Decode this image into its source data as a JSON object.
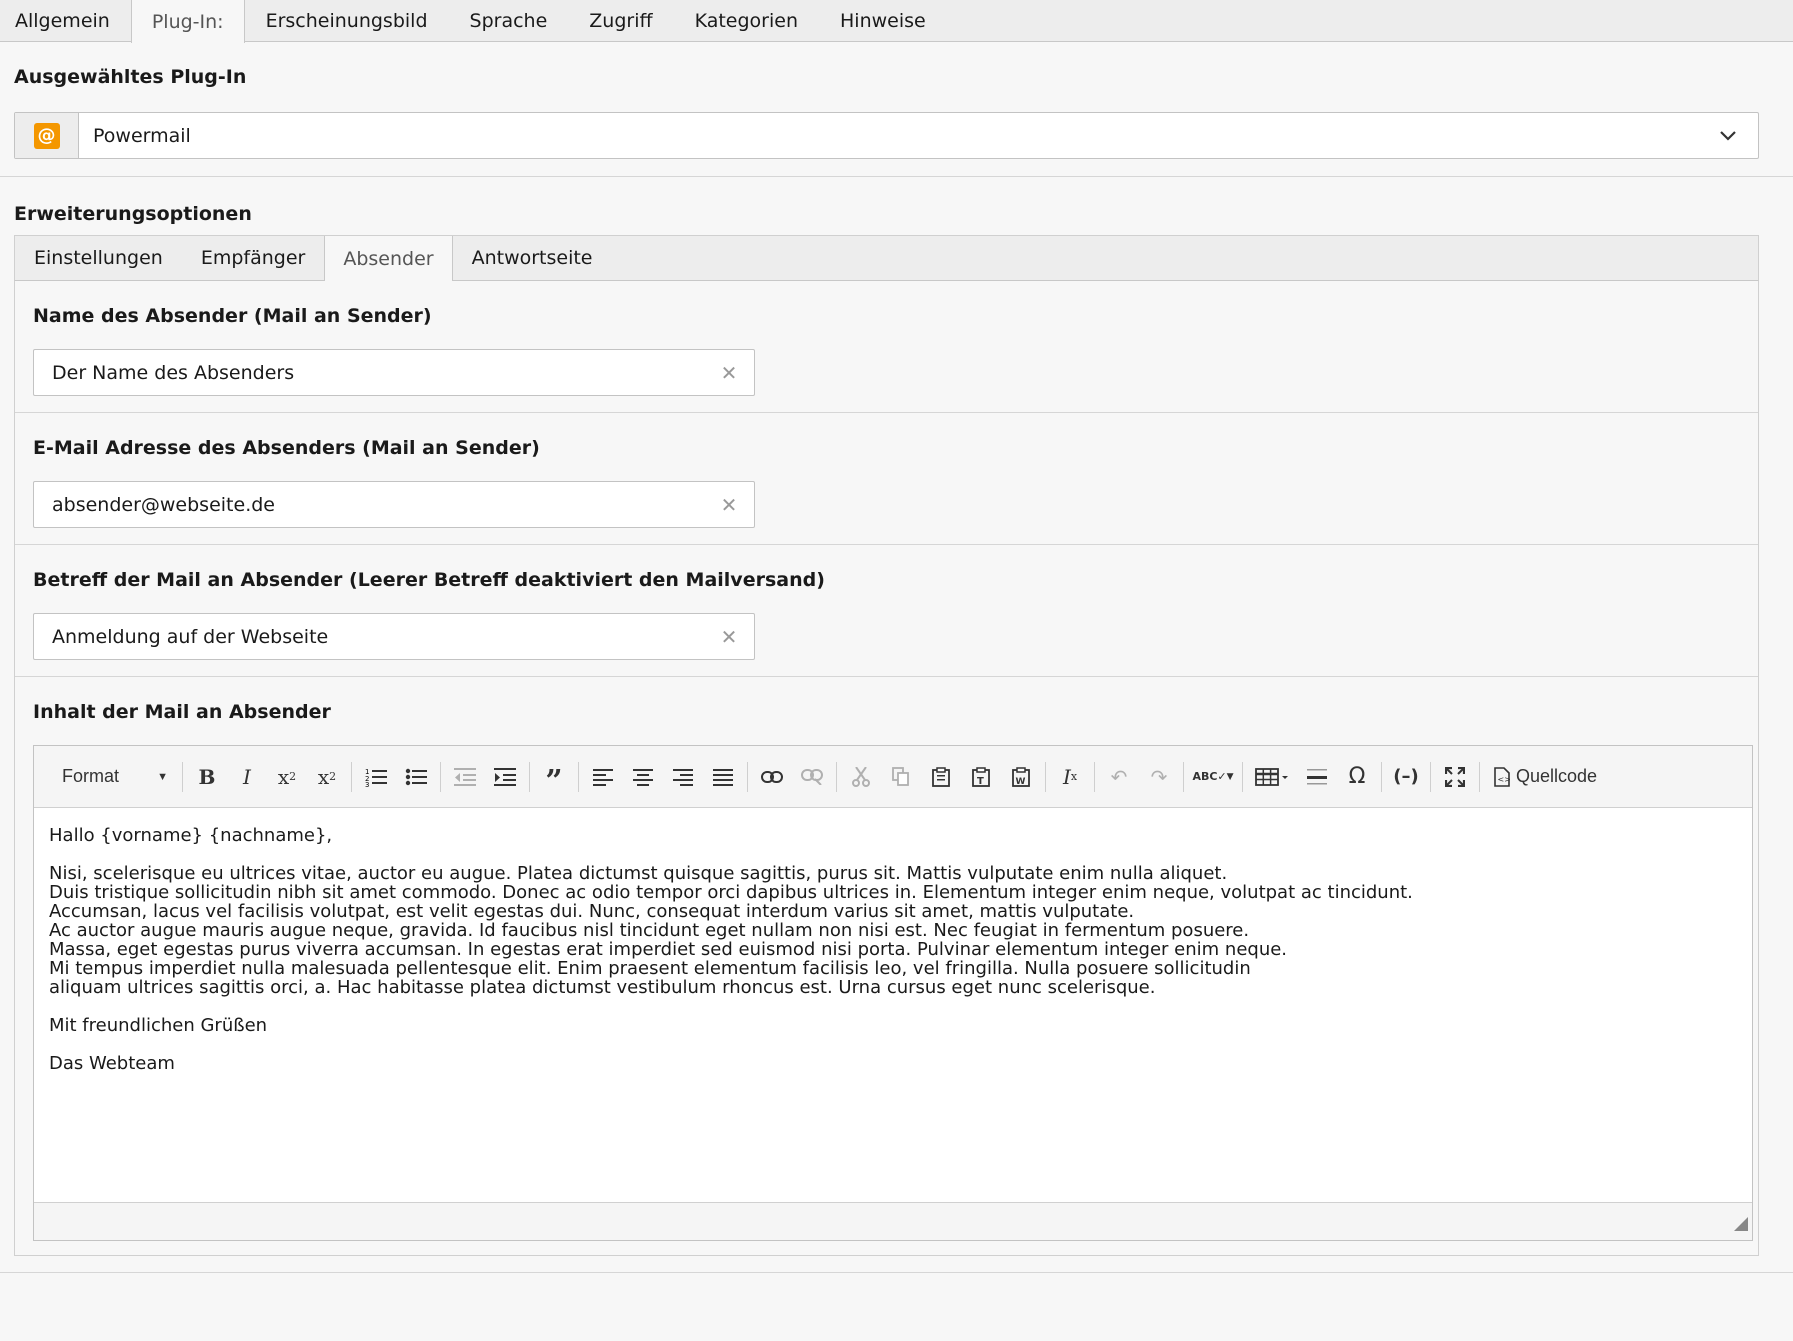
{
  "top_tabs": [
    "Allgemein",
    "Plug-In:",
    "Erscheinungsbild",
    "Sprache",
    "Zugriff",
    "Kategorien",
    "Hinweise"
  ],
  "active_top_tab": "Plug-In:",
  "plugin": {
    "section_title": "Ausgewähltes Plug-In",
    "selected": "Powermail",
    "icon_glyph": "@",
    "icon_color": "#f49700"
  },
  "extension": {
    "section_title": "Erweiterungsoptionen",
    "tabs": [
      "Einstellungen",
      "Empfänger",
      "Absender",
      "Antwortseite"
    ],
    "active_tab": "Absender"
  },
  "fields": {
    "sender_name": {
      "label": "Name des Absender (Mail an Sender)",
      "value": "Der Name des Absenders"
    },
    "sender_email": {
      "label": "E-Mail Adresse des Absenders (Mail an Sender)",
      "value": "absender@webseite.de"
    },
    "subject": {
      "label": "Betreff der Mail an Absender (Leerer Betreff deaktiviert den Mailversand)",
      "value": "Anmeldung auf der Webseite"
    },
    "body": {
      "label": "Inhalt der Mail an Absender"
    }
  },
  "editor": {
    "format_label": "Format",
    "source_label": "Quellcode",
    "toolbar_icons": [
      "bold-icon",
      "italic-icon",
      "subscript-icon",
      "superscript-icon",
      "numbered-list-icon",
      "bullet-list-icon",
      "outdent-icon",
      "indent-icon",
      "blockquote-icon",
      "align-left-icon",
      "align-center-icon",
      "align-right-icon",
      "justify-icon",
      "link-icon",
      "unlink-icon",
      "cut-icon",
      "copy-icon",
      "paste-icon",
      "paste-text-icon",
      "paste-word-icon",
      "remove-format-icon",
      "undo-icon",
      "redo-icon",
      "spellcheck-icon",
      "table-icon",
      "horizontal-line-icon",
      "special-char-icon",
      "soft-hyphen-icon",
      "maximize-icon",
      "source-icon"
    ],
    "content": {
      "greeting": "Hallo {vorname} {nachname},",
      "paragraph_lines": [
        "Nisi, scelerisque eu ultrices vitae, auctor eu augue. Platea dictumst quisque sagittis, purus sit. Mattis vulputate enim nulla aliquet.",
        "Duis tristique sollicitudin nibh sit amet commodo. Donec ac odio tempor orci dapibus ultrices in. Elementum integer enim neque, volutpat ac tincidunt.",
        "Accumsan, lacus vel facilisis volutpat, est velit egestas dui. Nunc, consequat interdum varius sit amet, mattis vulputate.",
        "Ac auctor augue mauris augue neque, gravida. Id faucibus nisl tincidunt eget nullam non nisi est. Nec feugiat in fermentum posuere.",
        "Massa, eget egestas purus viverra accumsan. In egestas erat imperdiet sed euismod nisi porta. Pulvinar elementum integer enim neque.",
        "Mi tempus imperdiet nulla malesuada pellentesque elit. Enim praesent elementum facilisis leo, vel fringilla. Nulla posuere sollicitudin",
        "aliquam ultrices sagittis orci, a. Hac habitasse platea dictumst vestibulum rhoncus est. Urna cursus eget nunc scelerisque."
      ],
      "closing": "Mit freundlichen Grüßen",
      "signature": "Das Webteam"
    }
  }
}
